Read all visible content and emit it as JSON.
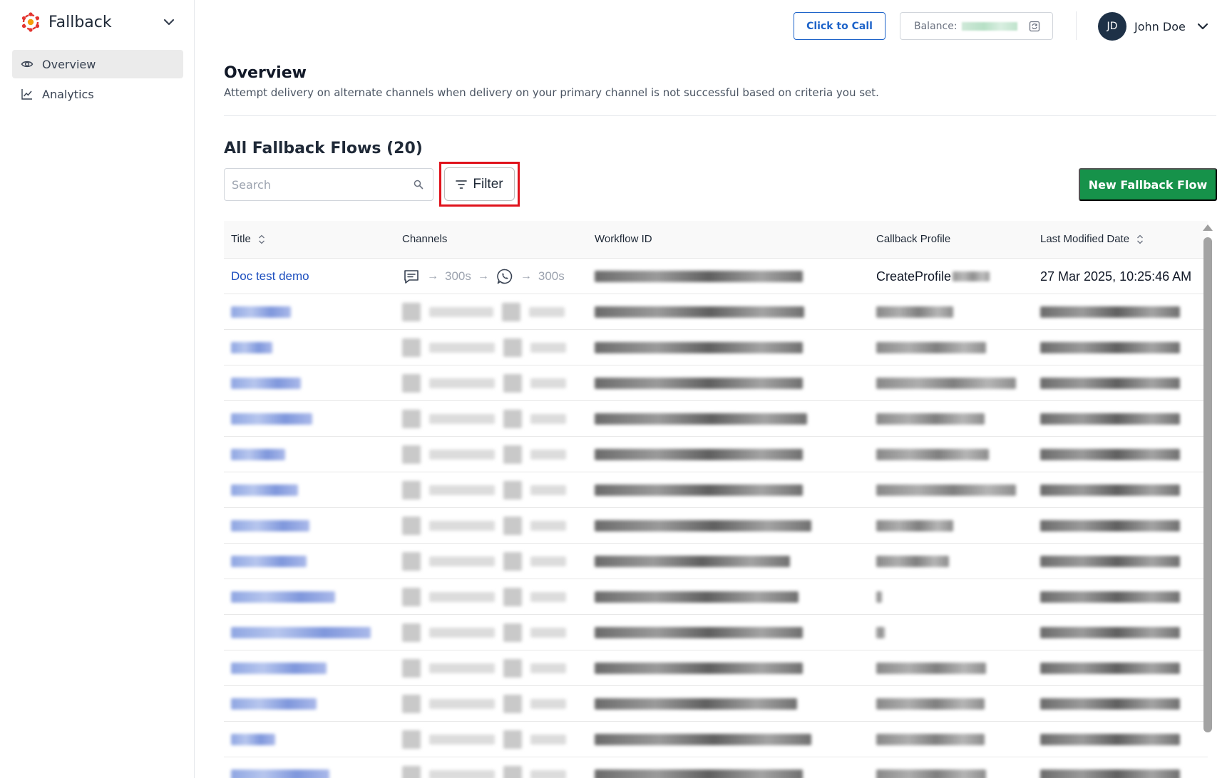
{
  "app": {
    "name": "Fallback"
  },
  "sidebar": {
    "items": [
      {
        "label": "Overview",
        "icon": "eye-icon",
        "active": true
      },
      {
        "label": "Analytics",
        "icon": "line-chart-icon",
        "active": false
      }
    ]
  },
  "header": {
    "call_button": "Click to Call",
    "balance_label": "Balance:",
    "user": {
      "initials": "JD",
      "name": "John Doe"
    }
  },
  "page": {
    "title": "Overview",
    "description": "Attempt delivery on alternate channels when delivery on your primary channel is not successful based on criteria you set."
  },
  "flows": {
    "title": "All Fallback Flows (20)",
    "search_placeholder": "Search",
    "filter_label": "Filter",
    "new_button": "New Fallback Flow",
    "columns": [
      "Title",
      "Channels",
      "Workflow ID",
      "Callback Profile",
      "Last Modified Date"
    ],
    "rows": [
      {
        "title": "Doc test demo",
        "channels": [
          {
            "icon": "sms-chat-icon"
          },
          {
            "delay": "300s",
            "icon": "whatsapp-icon"
          },
          {
            "delay": "300s"
          }
        ],
        "callback_profile": "CreateProfile",
        "last_modified": "27 Mar 2025, 10:25:46 AM"
      }
    ]
  },
  "colors": {
    "link": "#1d4fbf",
    "primary_blue": "#1d63c9",
    "success_green": "#16924a",
    "highlight_red": "#e0121b",
    "avatar_bg": "#1e3147",
    "brand_red": "#e3342f"
  }
}
